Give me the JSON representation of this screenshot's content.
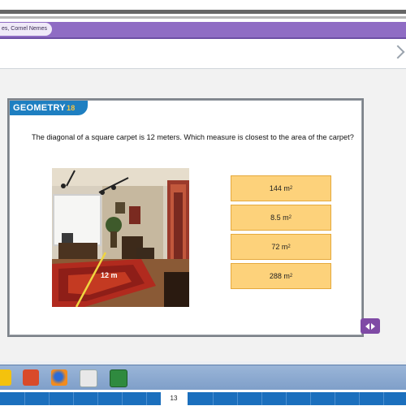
{
  "breadcrumb": {
    "text": "es, Cornel Nemes"
  },
  "card": {
    "logo_text": "GEOMETRY",
    "logo_accent": "18",
    "question": "The diagonal of a square carpet is 12 meters. Which measure is closest to the area of the carpet?"
  },
  "photo": {
    "label": "12 m"
  },
  "answers": [
    {
      "value": "144 m",
      "exp": "2"
    },
    {
      "value": "8.5 m",
      "exp": "2"
    },
    {
      "value": "72 m",
      "exp": "2"
    },
    {
      "value": "288 m",
      "exp": "2"
    }
  ],
  "footer": {
    "page_number": "13"
  },
  "colors": {
    "accent_purple": "#8f6cc4",
    "answer_fill": "#fdd27b",
    "logo_blue": "#1e7fc1",
    "taskbar_blue": "#1b6fbd"
  }
}
